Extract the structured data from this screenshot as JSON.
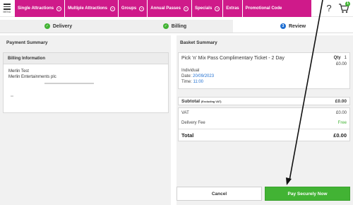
{
  "header": {
    "menu_label": "MENU",
    "nav_items": [
      {
        "label": "Single Attractions",
        "has_chevron": true
      },
      {
        "label": "Multiple Attractions",
        "has_chevron": true
      },
      {
        "label": "Groups",
        "has_chevron": true
      },
      {
        "label": "Annual Passes",
        "has_chevron": true
      },
      {
        "label": "Specials",
        "has_chevron": true
      },
      {
        "label": "Extras",
        "has_chevron": false
      },
      {
        "label": "Promotional Code",
        "has_chevron": false
      }
    ],
    "help_label": "?",
    "cart_count": "1"
  },
  "steps": [
    {
      "label": "Delivery",
      "status": "complete"
    },
    {
      "label": "Billing",
      "status": "complete"
    },
    {
      "label": "Review",
      "status": "current",
      "number": "3"
    }
  ],
  "payment_summary": {
    "title": "Payment Summary",
    "billing_info": {
      "heading": "Billing Information",
      "name": "Merlin Test",
      "company": "Merlin Entertainments plc"
    }
  },
  "basket_summary": {
    "title": "Basket Summary",
    "item": {
      "name": "Pick 'n' Mix Pass Complimentary Ticket - 2 Day",
      "type": "Individual",
      "date_label": "Date:",
      "date_value": "20/09/2023",
      "time_label": "Time:",
      "time_value": "11:00",
      "qty_label": "Qty",
      "qty_value": "1",
      "price": "£0.00"
    },
    "subtotal_label": "Subtotal",
    "subtotal_note": "(Excluding VAT)",
    "subtotal_value": "£0.00",
    "vat_label": "VAT",
    "vat_value": "£0.00",
    "delivery_label": "Delivery Fee",
    "delivery_value": "Free",
    "total_label": "Total",
    "total_value": "£0.00"
  },
  "actions": {
    "cancel_label": "Cancel",
    "pay_label": "Pay Securely Now"
  },
  "colors": {
    "nav_bg": "#cf1a8a",
    "accent_green": "#42b334",
    "step_blue": "#1f6fd1"
  }
}
